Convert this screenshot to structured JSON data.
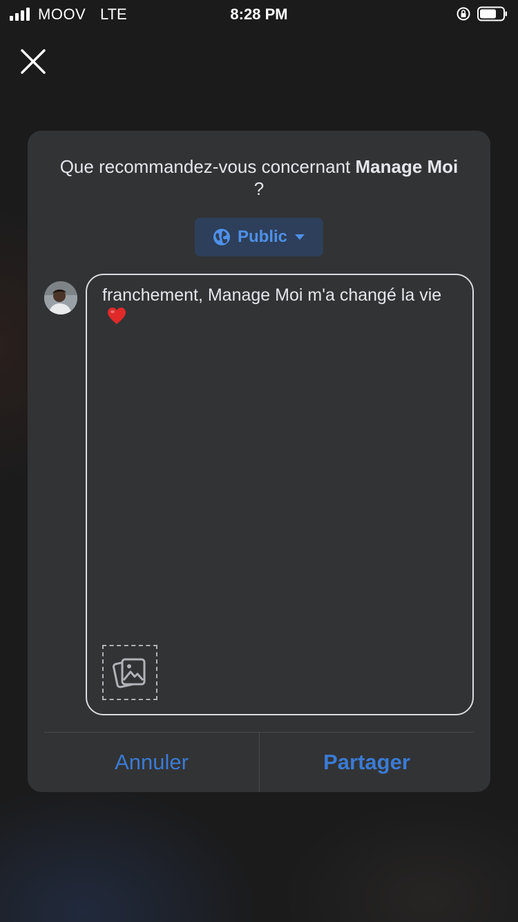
{
  "status_bar": {
    "carrier": "MOOV",
    "network": "LTE",
    "time": "8:28 PM",
    "icons": [
      "signal-icon",
      "orientation-lock-icon",
      "battery-icon"
    ]
  },
  "close": {
    "icon": "close-icon"
  },
  "dialog": {
    "prompt_prefix": "Que recommandez-vous concernant ",
    "page_name": "Manage Moi",
    "prompt_suffix": " ?",
    "audience": {
      "label": "Public",
      "icon": "globe-icon",
      "caret": "caret-down-icon"
    },
    "composer": {
      "text": "franchement, Manage Moi m'a changé la vie",
      "emoji": "heart-emoji",
      "photo_icon": "photo-icon"
    },
    "actions": {
      "cancel_label": "Annuler",
      "share_label": "Partager"
    }
  },
  "colors": {
    "accent": "#3a7bd5",
    "audience_text": "#4f90e8",
    "audience_bg": "#2d3f5a",
    "card_bg": "#323335",
    "page_bg": "#1b1b1c"
  }
}
